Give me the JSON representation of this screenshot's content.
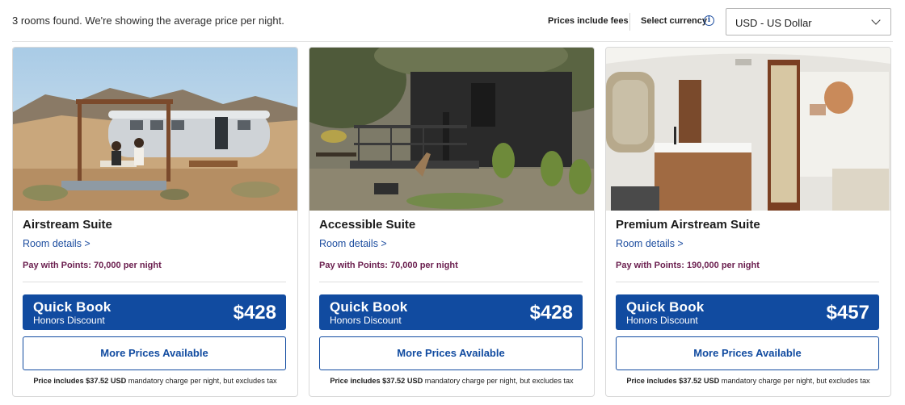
{
  "header": {
    "rooms_found": "3 rooms found. We're showing the average price per night.",
    "prices_include_fees": "Prices include fees",
    "select_currency_label": "Select currency",
    "currency_selected": "USD - US Dollar"
  },
  "rooms": [
    {
      "name": "Airstream Suite",
      "details_link": "Room details >",
      "points": "Pay with Points: 70,000 per night",
      "quickbook_title": "Quick Book",
      "quickbook_sub": "Honors Discount",
      "price": "$428",
      "more_prices": "More Prices Available",
      "fine_prefix": "Price includes $37.52 USD",
      "fine_suffix": "mandatory charge per night, but excludes tax"
    },
    {
      "name": "Accessible Suite",
      "details_link": "Room details >",
      "points": "Pay with Points: 70,000 per night",
      "quickbook_title": "Quick Book",
      "quickbook_sub": "Honors Discount",
      "price": "$428",
      "more_prices": "More Prices Available",
      "fine_prefix": "Price includes $37.52 USD",
      "fine_suffix": "mandatory charge per night, but excludes tax"
    },
    {
      "name": "Premium Airstream Suite",
      "details_link": "Room details >",
      "points": "Pay with Points: 190,000 per night",
      "quickbook_title": "Quick Book",
      "quickbook_sub": "Honors Discount",
      "price": "$457",
      "more_prices": "More Prices Available",
      "fine_prefix": "Price includes $37.52 USD",
      "fine_suffix": "mandatory charge per night, but excludes tax"
    }
  ],
  "colors": {
    "brand_blue": "#114ba0",
    "link_blue": "#1f4fa0",
    "points_purple": "#6a1e4e"
  },
  "icons": {
    "info": "info-icon",
    "dropdown": "chevron-down-icon"
  }
}
